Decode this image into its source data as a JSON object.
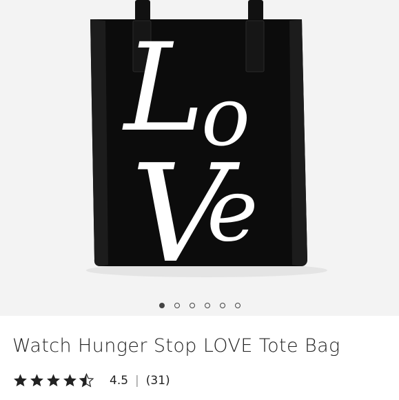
{
  "product": {
    "title": "Watch Hunger Stop LOVE Tote Bag",
    "image_text": "LOVE",
    "image_count": 6,
    "active_image_index": 0
  },
  "rating": {
    "score": "4.5",
    "separator": "|",
    "count": "(31)",
    "stars_value": 4.5,
    "stars_max": 5
  },
  "colors": {
    "gallery_bg": "#f3f3f3",
    "bag": "#0c0c0c",
    "text": "#222222"
  },
  "icons": [
    "star-icon",
    "half-star-icon",
    "dot-indicator"
  ]
}
